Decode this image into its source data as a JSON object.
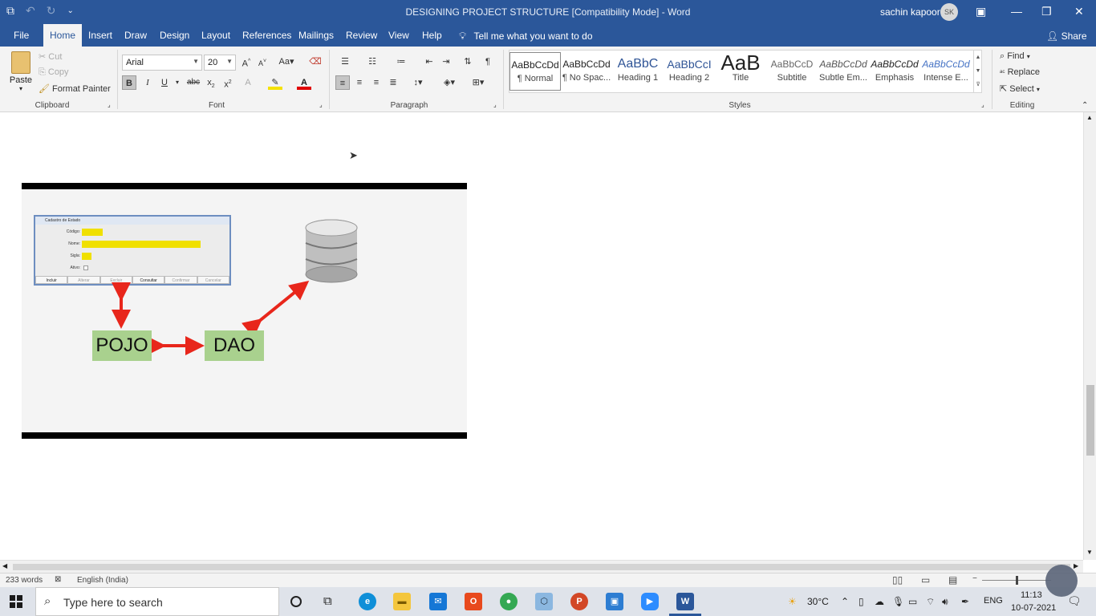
{
  "window": {
    "doc_title": "DESIGNING PROJECT STRUCTURE [Compatibility Mode]  -  Word",
    "user_name": "sachin kapoor",
    "user_initials": "SK"
  },
  "tabs": [
    {
      "label": "File"
    },
    {
      "label": "Home"
    },
    {
      "label": "Insert"
    },
    {
      "label": "Draw"
    },
    {
      "label": "Design"
    },
    {
      "label": "Layout"
    },
    {
      "label": "References"
    },
    {
      "label": "Mailings"
    },
    {
      "label": "Review"
    },
    {
      "label": "View"
    },
    {
      "label": "Help"
    }
  ],
  "tell_me": "Tell me what you want to do",
  "share": "Share",
  "clipboard": {
    "paste": "Paste",
    "cut": "Cut",
    "copy": "Copy",
    "format_painter": "Format Painter",
    "label": "Clipboard"
  },
  "font": {
    "family": "Arial",
    "size": "20",
    "label": "Font"
  },
  "paragraph": {
    "label": "Paragraph"
  },
  "styles": {
    "label": "Styles",
    "items": [
      {
        "sample": "AaBbCcDd",
        "name": "¶ Normal"
      },
      {
        "sample": "AaBbCcDd",
        "name": "¶ No Spac..."
      },
      {
        "sample": "AaBbC",
        "name": "Heading 1"
      },
      {
        "sample": "AaBbCcI",
        "name": "Heading 2"
      },
      {
        "sample": "AaB",
        "name": "Title"
      },
      {
        "sample": "AaBbCcD",
        "name": "Subtitle"
      },
      {
        "sample": "AaBbCcDd",
        "name": "Subtle Em..."
      },
      {
        "sample": "AaBbCcDd",
        "name": "Emphasis"
      },
      {
        "sample": "AaBbCcDd",
        "name": "Intense E..."
      }
    ]
  },
  "editing": {
    "find": "Find",
    "replace": "Replace",
    "select": "Select",
    "label": "Editing"
  },
  "figure": {
    "form_title": "Cadastro de Estado",
    "fields": [
      "Código:",
      "Nome:",
      "Sigla:",
      "Ativo:"
    ],
    "buttons": [
      "Incluir",
      "Alterar",
      "Excluir",
      "Consultar",
      "Confirmar",
      "Cancelar"
    ],
    "pojo": "POJO",
    "dao": "DAO"
  },
  "status": {
    "words": "233 words",
    "language": "English (India)"
  },
  "taskbar": {
    "search": "Type here to search",
    "temperature": "30°C",
    "lang": "ENG",
    "time": "11:13",
    "date": "10-07-2021"
  }
}
